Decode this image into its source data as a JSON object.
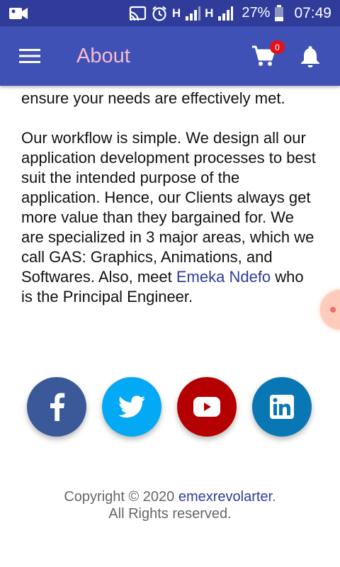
{
  "status_bar": {
    "network_label_1": "H",
    "network_label_2": "H",
    "battery_percent": "27%",
    "time": "07:49",
    "icons": [
      "video-camera-icon",
      "cast-icon",
      "alarm-icon",
      "signal-icon",
      "signal-icon",
      "battery-icon"
    ]
  },
  "app_bar": {
    "title": "About",
    "cart_count": "0",
    "colors": {
      "background": "#3f51b5",
      "title": "#f8bbd0",
      "badge": "#e2121b"
    }
  },
  "content": {
    "paragraph_1": "ensure your needs are effectively met.",
    "paragraph_2_text": " Our workflow is simple. We design all our application development processes to best suit the intended purpose of the application. Hence, our Clients always get more value than they bargained for. We are specialized in 3 major areas, which we call GAS: Graphics, Animations, and Softwares. Also, meet ",
    "engineer_name": "Emeka Ndefo",
    "paragraph_2_tail": " who is the Principal Engineer."
  },
  "social": {
    "buttons": [
      {
        "icon": "facebook-icon",
        "color": "#3b5998"
      },
      {
        "icon": "twitter-icon",
        "color": "#03a9f4"
      },
      {
        "icon": "youtube-icon",
        "color": "#b40000"
      },
      {
        "icon": "linkedin-icon",
        "color": "#0a77b5"
      }
    ]
  },
  "footer": {
    "copyright_prefix": "Copyright © 2020 ",
    "brand": "emexrevolarter",
    "period": ".",
    "rights": "All Rights reserved."
  }
}
